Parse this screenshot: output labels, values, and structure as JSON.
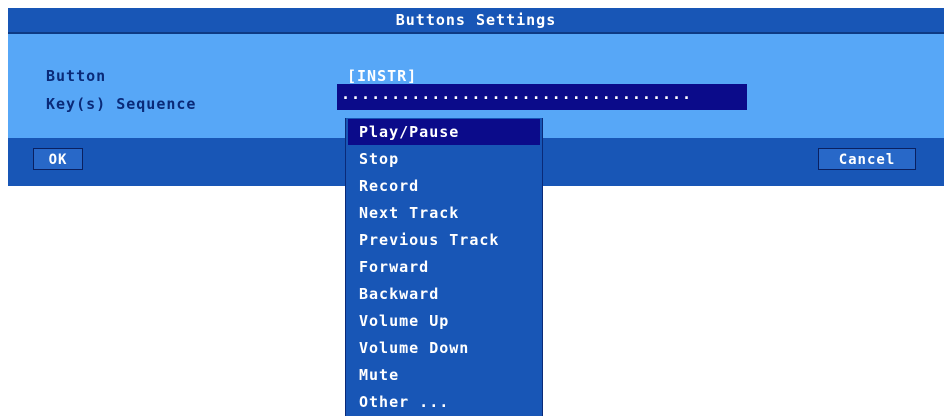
{
  "dialog": {
    "title": "Buttons Settings",
    "fields": [
      {
        "label": "Button",
        "value": "[INSTR]"
      },
      {
        "label": "Key(s) Sequence",
        "value": "..................................."
      }
    ],
    "ok_label": "OK",
    "cancel_label": "Cancel"
  },
  "dropdown": {
    "selected": "Play/Pause",
    "options": [
      "Play/Pause",
      "Stop",
      "Record",
      "Next Track",
      "Previous Track",
      "Forward",
      "Backward",
      "Volume Up",
      "Volume Down",
      "Mute",
      "Other ..."
    ]
  },
  "colors": {
    "dialog_background": "#57a7f7",
    "title_bar": "#1856b6",
    "selection": "#0b0b8a",
    "label_text": "#0a2a78",
    "value_text": "#ffffff"
  }
}
